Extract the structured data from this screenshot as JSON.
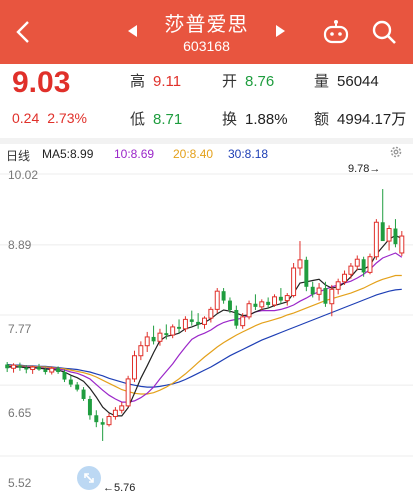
{
  "header": {
    "title": "莎普爱思",
    "code": "603168",
    "bg_color": "#e8553f",
    "icons": [
      "back-icon",
      "prev-arrow-icon",
      "next-arrow-icon",
      "robot-assistant-icon",
      "search-icon"
    ]
  },
  "quote": {
    "price": "9.03",
    "change": "0.24",
    "change_pct": "2.73%",
    "high_label": "高",
    "high": "9.11",
    "open_label": "开",
    "open": "8.76",
    "volume_label": "量",
    "volume": "56044",
    "low_label": "低",
    "low": "8.71",
    "turnover_label": "换",
    "turnover": "1.88%",
    "amount_label": "额",
    "amount": "4994.17万"
  },
  "ma_bar": {
    "period": "日线",
    "ma5": "MA5:8.99",
    "ma10": "10:8.69",
    "ma20": "20:8.40",
    "ma30": "30:8.18",
    "colors": {
      "ma5": "#222222",
      "ma10": "#9b27c9",
      "ma20": "#e4a11b",
      "ma30": "#1e3fb5"
    }
  },
  "chart_labels": {
    "y_ticks": [
      "10.02",
      "8.89",
      "7.77",
      "6.65",
      "5.52"
    ],
    "max_annotation": "9.78→",
    "min_annotation": "←5.76"
  },
  "chart_data": {
    "type": "candlestick",
    "ylim": [
      5.52,
      10.02
    ],
    "y_ticks": [
      10.02,
      8.89,
      7.77,
      6.65,
      5.52
    ],
    "max_price": 9.78,
    "min_price": 5.76,
    "colors": {
      "up": "#e0302a",
      "down": "#1f9d3f"
    },
    "candles": [
      [
        6.98,
        7.02,
        6.86,
        6.92
      ],
      [
        6.92,
        7.0,
        6.85,
        6.97
      ],
      [
        6.96,
        7.01,
        6.88,
        6.93
      ],
      [
        6.93,
        6.97,
        6.84,
        6.9
      ],
      [
        6.9,
        6.96,
        6.83,
        6.94
      ],
      [
        6.94,
        6.99,
        6.88,
        6.9
      ],
      [
        6.9,
        6.93,
        6.82,
        6.86
      ],
      [
        6.86,
        6.95,
        6.82,
        6.92
      ],
      [
        6.92,
        6.95,
        6.83,
        6.86
      ],
      [
        6.86,
        6.9,
        6.7,
        6.74
      ],
      [
        6.74,
        6.8,
        6.62,
        6.66
      ],
      [
        6.66,
        6.7,
        6.55,
        6.58
      ],
      [
        6.58,
        6.62,
        6.4,
        6.43
      ],
      [
        6.43,
        6.48,
        6.1,
        6.17
      ],
      [
        6.17,
        6.25,
        5.98,
        6.06
      ],
      [
        6.06,
        6.12,
        5.76,
        6.02
      ],
      [
        6.02,
        6.2,
        5.99,
        6.15
      ],
      [
        6.15,
        6.3,
        6.1,
        6.25
      ],
      [
        6.25,
        6.38,
        6.2,
        6.32
      ],
      [
        6.32,
        6.8,
        6.3,
        6.75
      ],
      [
        6.75,
        7.2,
        6.7,
        7.12
      ],
      [
        7.12,
        7.35,
        7.05,
        7.28
      ],
      [
        7.28,
        7.5,
        7.18,
        7.42
      ],
      [
        7.42,
        7.6,
        7.3,
        7.35
      ],
      [
        7.35,
        7.55,
        7.28,
        7.48
      ],
      [
        7.48,
        7.62,
        7.38,
        7.45
      ],
      [
        7.45,
        7.62,
        7.4,
        7.58
      ],
      [
        7.58,
        7.7,
        7.48,
        7.55
      ],
      [
        7.55,
        7.75,
        7.5,
        7.7
      ],
      [
        7.7,
        7.84,
        7.6,
        7.66
      ],
      [
        7.66,
        7.8,
        7.55,
        7.62
      ],
      [
        7.62,
        7.75,
        7.55,
        7.72
      ],
      [
        7.72,
        7.9,
        7.65,
        7.86
      ],
      [
        7.86,
        8.2,
        7.8,
        8.15
      ],
      [
        8.15,
        8.2,
        7.95,
        8.0
      ],
      [
        8.0,
        8.05,
        7.8,
        7.85
      ],
      [
        7.85,
        7.92,
        7.55,
        7.6
      ],
      [
        7.6,
        7.8,
        7.55,
        7.74
      ],
      [
        7.74,
        8.0,
        7.7,
        7.95
      ],
      [
        7.95,
        8.1,
        7.85,
        7.9
      ],
      [
        7.9,
        8.02,
        7.85,
        7.98
      ],
      [
        7.98,
        8.05,
        7.88,
        7.93
      ],
      [
        7.93,
        8.1,
        7.9,
        8.06
      ],
      [
        8.06,
        8.2,
        7.95,
        8.0
      ],
      [
        8.0,
        8.12,
        7.92,
        8.08
      ],
      [
        8.08,
        8.6,
        8.05,
        8.52
      ],
      [
        8.52,
        8.95,
        8.4,
        8.65
      ],
      [
        8.65,
        8.7,
        8.15,
        8.22
      ],
      [
        8.22,
        8.3,
        8.05,
        8.1
      ],
      [
        8.1,
        8.28,
        8.0,
        8.2
      ],
      [
        8.2,
        8.3,
        7.9,
        7.95
      ],
      [
        7.95,
        8.25,
        7.75,
        8.18
      ],
      [
        8.18,
        8.35,
        8.1,
        8.3
      ],
      [
        8.3,
        8.48,
        8.25,
        8.42
      ],
      [
        8.42,
        8.6,
        8.35,
        8.55
      ],
      [
        8.55,
        8.72,
        8.48,
        8.66
      ],
      [
        8.66,
        8.7,
        8.38,
        8.45
      ],
      [
        8.45,
        8.75,
        8.42,
        8.7
      ],
      [
        8.7,
        9.3,
        8.65,
        9.25
      ],
      [
        9.25,
        9.78,
        9.1,
        8.95
      ],
      [
        8.95,
        9.2,
        8.8,
        9.15
      ],
      [
        9.15,
        9.3,
        8.85,
        8.9
      ],
      [
        8.76,
        9.11,
        8.71,
        9.03
      ]
    ],
    "ma5": [
      6.94,
      6.94,
      6.94,
      6.93,
      6.93,
      6.92,
      6.91,
      6.9,
      6.89,
      6.86,
      6.81,
      6.77,
      6.71,
      6.6,
      6.46,
      6.3,
      6.21,
      6.16,
      6.16,
      6.29,
      6.52,
      6.76,
      6.96,
      7.17,
      7.36,
      7.43,
      7.45,
      7.48,
      7.55,
      7.58,
      7.62,
      7.65,
      7.71,
      7.79,
      7.85,
      7.83,
      7.8,
      7.76,
      7.77,
      7.82,
      7.86,
      7.88,
      7.92,
      7.95,
      7.98,
      8.12,
      8.28,
      8.3,
      8.32,
      8.34,
      8.25,
      8.2,
      8.22,
      8.28,
      8.38,
      8.5,
      8.5,
      8.56,
      8.74,
      8.86,
      8.98,
      9.04,
      8.99
    ],
    "ma10": [
      6.95,
      6.95,
      6.94,
      6.94,
      6.94,
      6.93,
      6.92,
      6.92,
      6.91,
      6.89,
      6.86,
      6.84,
      6.8,
      6.75,
      6.66,
      6.57,
      6.49,
      6.43,
      6.38,
      6.38,
      6.4,
      6.45,
      6.52,
      6.62,
      6.75,
      6.87,
      6.99,
      7.13,
      7.26,
      7.38,
      7.44,
      7.48,
      7.53,
      7.6,
      7.65,
      7.68,
      7.7,
      7.72,
      7.77,
      7.82,
      7.84,
      7.84,
      7.84,
      7.86,
      7.89,
      7.93,
      7.99,
      8.04,
      8.1,
      8.14,
      8.18,
      8.22,
      8.25,
      8.28,
      8.31,
      8.36,
      8.42,
      8.5,
      8.6,
      8.68,
      8.72,
      8.76,
      8.69
    ],
    "ma20": [
      6.97,
      6.96,
      6.96,
      6.95,
      6.95,
      6.94,
      6.94,
      6.93,
      6.92,
      6.91,
      6.89,
      6.87,
      6.85,
      6.82,
      6.78,
      6.73,
      6.68,
      6.63,
      6.58,
      6.55,
      6.52,
      6.51,
      6.51,
      6.53,
      6.57,
      6.62,
      6.68,
      6.75,
      6.83,
      6.92,
      7.01,
      7.1,
      7.18,
      7.26,
      7.33,
      7.39,
      7.45,
      7.5,
      7.55,
      7.6,
      7.64,
      7.67,
      7.7,
      7.73,
      7.77,
      7.8,
      7.84,
      7.88,
      7.92,
      7.96,
      8.0,
      8.03,
      8.06,
      8.09,
      8.12,
      8.16,
      8.2,
      8.25,
      8.3,
      8.34,
      8.37,
      8.4,
      8.4
    ],
    "ma30": [
      6.98,
      6.97,
      6.97,
      6.96,
      6.96,
      6.95,
      6.95,
      6.94,
      6.93,
      6.92,
      6.91,
      6.9,
      6.88,
      6.86,
      6.83,
      6.8,
      6.76,
      6.73,
      6.7,
      6.67,
      6.65,
      6.63,
      6.62,
      6.62,
      6.63,
      6.65,
      6.67,
      6.7,
      6.74,
      6.79,
      6.84,
      6.89,
      6.94,
      7.0,
      7.06,
      7.12,
      7.17,
      7.22,
      7.27,
      7.32,
      7.37,
      7.41,
      7.45,
      7.49,
      7.53,
      7.57,
      7.61,
      7.65,
      7.69,
      7.73,
      7.77,
      7.81,
      7.85,
      7.89,
      7.93,
      7.97,
      8.01,
      8.05,
      8.09,
      8.12,
      8.15,
      8.17,
      8.18
    ]
  }
}
